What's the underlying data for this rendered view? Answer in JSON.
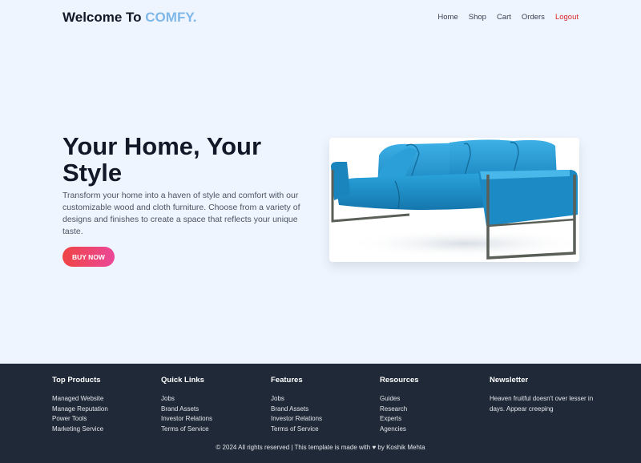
{
  "nav": {
    "brand_prefix": "Welcome To ",
    "brand_accent": "COMFY.",
    "links": [
      "Home",
      "Shop",
      "Cart",
      "Orders",
      "Logout"
    ]
  },
  "hero": {
    "title": "Your Home, Your Style",
    "description": "Transform your home into a haven of style and comfort with our customizable wood and cloth furniture. Choose from a variety of designs and finishes to create a space that reflects your unique taste.",
    "button": "BUY NOW",
    "image_icon": "sofa-image"
  },
  "footer": {
    "columns": [
      {
        "title": "Top Products",
        "items": [
          "Managed Website",
          "Manage Reputation",
          "Power Tools",
          "Marketing Service"
        ]
      },
      {
        "title": "Quick Links",
        "items": [
          "Jobs",
          "Brand Assets",
          "Investor Relations",
          "Terms of Service"
        ]
      },
      {
        "title": "Features",
        "items": [
          "Jobs",
          "Brand Assets",
          "Investor Relations",
          "Terms of Service"
        ]
      },
      {
        "title": "Resources",
        "items": [
          "Guides",
          "Research",
          "Experts",
          "Agencies"
        ]
      }
    ],
    "newsletter": {
      "title": "Newsletter",
      "text": "Heaven fruitful doesn't over lesser in days. Appear creeping"
    },
    "copyright": "© 2024 All rights reserved | This template is made with ♥ by Koshik Mehta"
  },
  "colors": {
    "page_bg": "#eef5ff",
    "accent": "#7fb8e8",
    "logout": "#dc2626",
    "footer_bg": "#1f2937",
    "sofa": "#1e8fc9"
  }
}
